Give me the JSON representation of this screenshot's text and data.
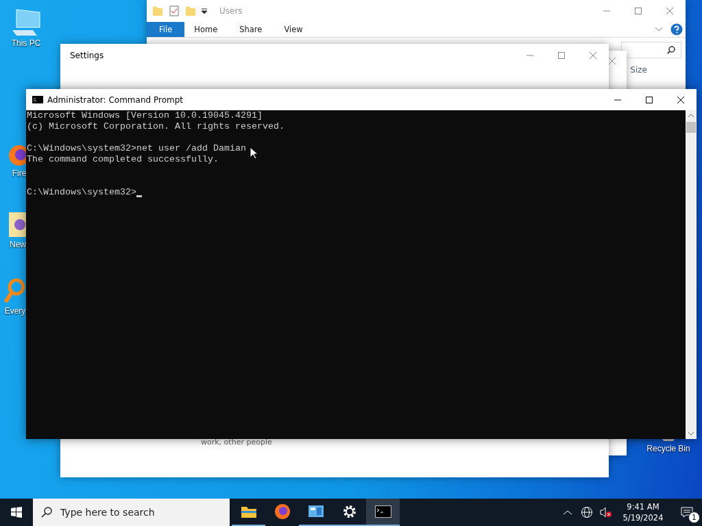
{
  "desktop_icons": [
    {
      "kind": "pc",
      "label": "This PC"
    },
    {
      "kind": "firefox",
      "label": "Fire"
    },
    {
      "kind": "folder",
      "label": "New"
    },
    {
      "kind": "magnifier",
      "label": "Every"
    },
    {
      "kind": "bin",
      "label": "Recycle Bin"
    }
  ],
  "explorer": {
    "title": "Users",
    "ribbon_tabs": [
      {
        "label": "File",
        "selected": true
      },
      {
        "label": "Home",
        "selected": false
      },
      {
        "label": "Share",
        "selected": false
      },
      {
        "label": "View",
        "selected": false
      }
    ],
    "column_header": "Size"
  },
  "settings": {
    "title": "Settings",
    "text": "work, other people"
  },
  "console": {
    "title": "Administrator: Command Prompt",
    "lines": [
      {
        "kind": "text",
        "text": "Microsoft Windows [Version 10.0.19045.4291]"
      },
      {
        "kind": "text",
        "text": "(c) Microsoft Corporation. All rights reserved."
      },
      {
        "kind": "blank"
      },
      {
        "kind": "text",
        "text": "C:\\Windows\\system32>net user /add Damian"
      },
      {
        "kind": "text",
        "text": "The command completed successfully."
      },
      {
        "kind": "blank"
      },
      {
        "kind": "blank"
      },
      {
        "kind": "prompt",
        "text": "C:\\Windows\\system32>"
      }
    ]
  },
  "taskbar": {
    "search_placeholder": "Type here to search",
    "apps": [
      {
        "kind": "explorer",
        "running": true,
        "selected": false
      },
      {
        "kind": "firefox",
        "running": false,
        "selected": false
      },
      {
        "kind": "control",
        "running": true,
        "selected": false
      },
      {
        "kind": "settings",
        "running": true,
        "selected": false
      },
      {
        "kind": "cmd",
        "running": true,
        "selected": true
      }
    ],
    "time": "9:41 AM",
    "date": "5/19/2024",
    "notification_count": "1"
  }
}
